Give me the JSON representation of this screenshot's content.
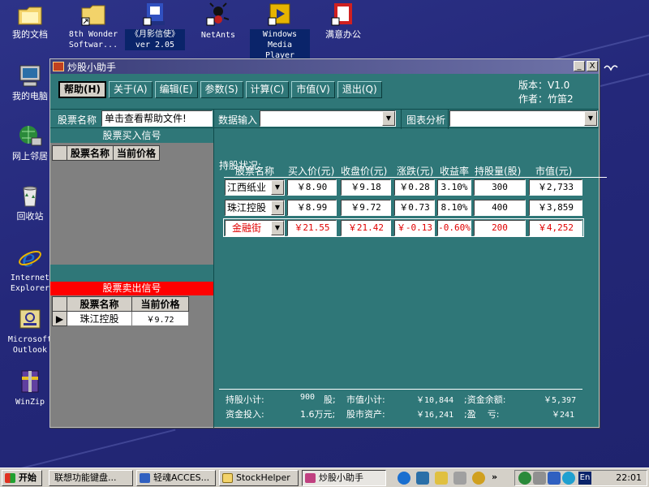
{
  "desktop": {
    "icons": [
      {
        "label": "我的文档",
        "icon": "folder-documents-icon"
      },
      {
        "label": "8th Wonder Softwar...",
        "icon": "folder-shortcut-icon"
      },
      {
        "label": "《月影信使》 ver 2.05",
        "icon": "app-shortcut-icon"
      },
      {
        "label": "NetAnts",
        "icon": "netants-icon"
      },
      {
        "label": "Windows Media Player",
        "icon": "media-player-icon"
      },
      {
        "label": "满意办公",
        "icon": "office-app-icon"
      },
      {
        "label": "我的电脑",
        "icon": "computer-icon"
      },
      {
        "label": "网上邻居",
        "icon": "network-icon"
      },
      {
        "label": "回收站",
        "icon": "recycle-bin-icon"
      },
      {
        "label": "Internet Explorer",
        "icon": "ie-icon"
      },
      {
        "label": "Microsoft Outlook",
        "icon": "outlook-icon"
      },
      {
        "label": "WinZip",
        "icon": "winzip-icon"
      }
    ]
  },
  "window": {
    "title": "炒股小助手",
    "minimize": "_",
    "close": "X",
    "menu": [
      "帮助(H)",
      "关于(A)",
      "编辑(E)",
      "参数(S)",
      "计算(C)",
      "市值(V)",
      "退出(Q)"
    ],
    "version": "版本：V1.0",
    "author": "作者：竹笛2",
    "stock_name_label": "股票名称",
    "stock_name_combo": "单击查看帮助文件!",
    "data_input_label": "数据输入",
    "chart_label": "图表分析",
    "buy_signal_title": "股票买入信号",
    "sell_signal_title": "股票卖出信号",
    "grid_headers": [
      "股票名称",
      "当前价格"
    ],
    "sell_rows": [
      {
        "name": "珠江控股",
        "price": "￥9.72"
      }
    ],
    "holdings_title": "持股状况:",
    "holdings_headers": [
      "股票名称",
      "买入价(元)",
      "收盘价(元)",
      "涨跌(元)",
      "收益率",
      "持股量(股)",
      "市值(元)"
    ],
    "holdings": [
      {
        "name": "江西纸业",
        "buy": "￥8.90",
        "close": "￥9.18",
        "change": "￥0.28",
        "yield": "3.10%",
        "qty": "300",
        "value": "￥2,733"
      },
      {
        "name": "珠江控股",
        "buy": "￥8.99",
        "close": "￥9.72",
        "change": "￥0.73",
        "yield": "8.10%",
        "qty": "400",
        "value": "￥3,859"
      },
      {
        "name": "金融街",
        "buy": "￥21.55",
        "close": "￥21.42",
        "change": "￥-0.13",
        "yield": "-0.60%",
        "qty": "200",
        "value": "￥4,252"
      }
    ],
    "summary": {
      "hold_subtotal_label": "持股小计:",
      "hold_subtotal": "900",
      "hold_unit": "股;",
      "value_subtotal_label": "市值小计:",
      "value_subtotal": "￥10,844",
      "cash_label": ";资金余额:",
      "cash": "￥5,397",
      "invest_label": "资金投入:",
      "invest": "1.6万元;",
      "assets_label": "股市资产:",
      "assets": "￥16,241",
      "pl_label": ";盈    亏:",
      "pl": "￥241"
    }
  },
  "taskbar": {
    "start": "开始",
    "tasks": [
      "联想功能键盘...",
      "轻魂ACCES...",
      "StockHelper",
      "炒股小助手"
    ],
    "clock": "22:01",
    "tray_lang": "En"
  },
  "colors": {
    "window_bg": "#2f7778",
    "sell_title": "#ff0000",
    "titlebar": "#3a3d7a",
    "loss_text": "#e00000"
  }
}
